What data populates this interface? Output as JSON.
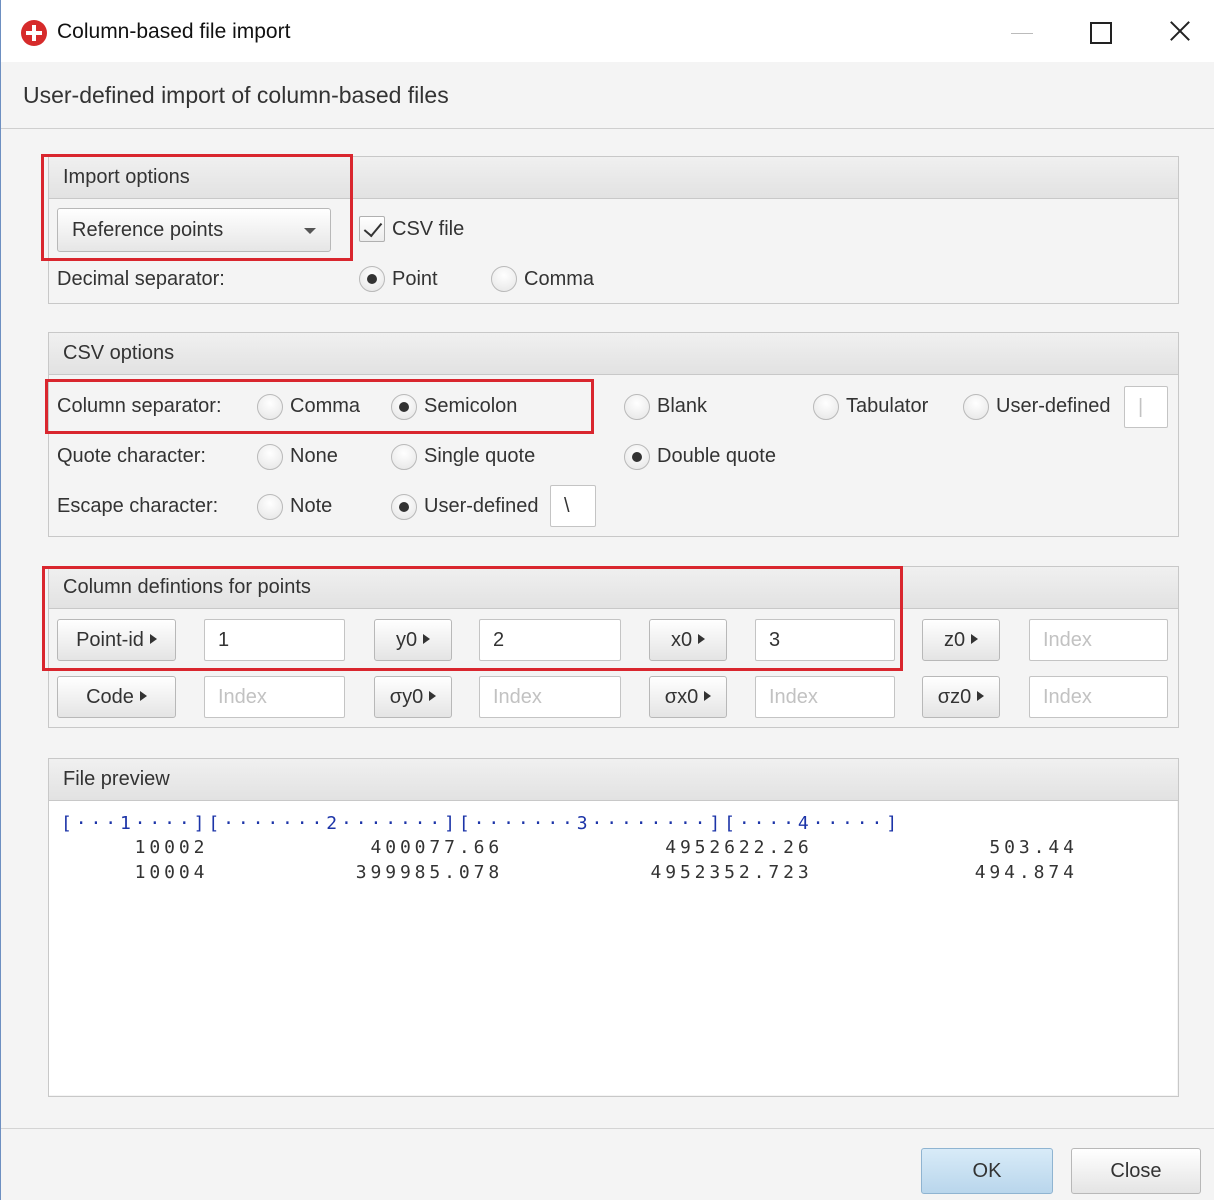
{
  "window": {
    "title": "Column-based file import"
  },
  "header": {
    "text": "User-defined import of column-based files"
  },
  "import_options": {
    "title": "Import options",
    "type_select": "Reference points",
    "csv_file_label": "CSV file",
    "csv_file_checked": true,
    "decimal_label": "Decimal separator:",
    "decimal_point": "Point",
    "decimal_comma": "Comma",
    "decimal_selected": "Point"
  },
  "csv_options": {
    "title": "CSV options",
    "column_sep_label": "Column separator:",
    "column_sep": {
      "comma": "Comma",
      "semicolon": "Semicolon",
      "blank": "Blank",
      "tabulator": "Tabulator",
      "user_defined": "User-defined",
      "user_value": "|",
      "selected": "Semicolon"
    },
    "quote_label": "Quote character:",
    "quote": {
      "none": "None",
      "single": "Single quote",
      "double": "Double quote",
      "selected": "Double quote"
    },
    "escape_label": "Escape character:",
    "escape": {
      "note": "Note",
      "user_defined": "User-defined",
      "user_value": "\\",
      "selected": "User-defined"
    }
  },
  "column_defs": {
    "title": "Column defintions for points",
    "row1": [
      {
        "button": "Point-id",
        "value": "1",
        "placeholder": "Index"
      },
      {
        "button": "y0",
        "value": "2",
        "placeholder": "Index"
      },
      {
        "button": "x0",
        "value": "3",
        "placeholder": "Index"
      },
      {
        "button": "z0",
        "value": "",
        "placeholder": "Index"
      }
    ],
    "row2": [
      {
        "button": "Code",
        "value": "",
        "placeholder": "Index"
      },
      {
        "button": "σy0",
        "value": "",
        "placeholder": "Index"
      },
      {
        "button": "σx0",
        "value": "",
        "placeholder": "Index"
      },
      {
        "button": "σz0",
        "value": "",
        "placeholder": "Index"
      }
    ]
  },
  "file_preview": {
    "title": "File preview",
    "ruler": "[···1····][·······2·······][·······3········][····4·····]",
    "lines": [
      "     10002           400077.66           4952622.26            503.44",
      "     10004          399985.078          4952352.723           494.874"
    ]
  },
  "footer": {
    "ok": "OK",
    "close": "Close"
  }
}
